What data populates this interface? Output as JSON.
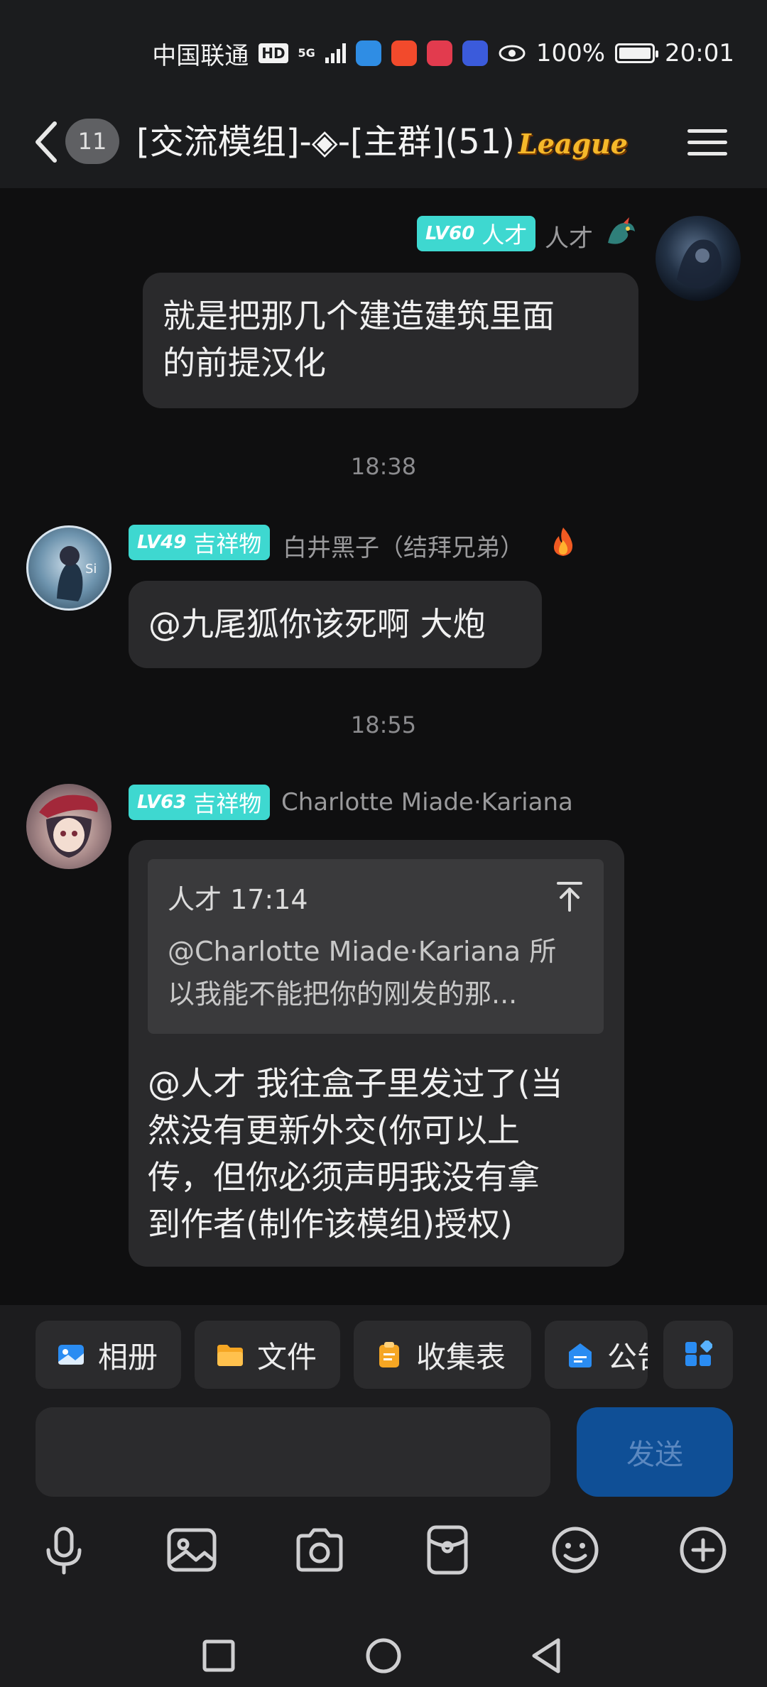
{
  "status_bar": {
    "carrier": "中国联通",
    "hd": "HD",
    "network": "5G",
    "battery": "100%",
    "time": "20:01"
  },
  "header": {
    "unread_count": "11",
    "title": "[交流模组]-◈-[主群](51)",
    "badge": "League"
  },
  "messages": [
    {
      "level": "LV60",
      "role": "人才",
      "sender": "人才",
      "text_lines": [
        "就是把那几个建造建筑里面",
        "的前提汉化"
      ]
    },
    {
      "time": "18:38",
      "level": "LV49",
      "role": "吉祥物",
      "sender": "白井黑子（结拜兄弟）",
      "text": "@九尾狐你该死啊 大炮"
    },
    {
      "time": "18:55",
      "level": "LV63",
      "role": "吉祥物",
      "sender": "Charlotte Miade·Kariana",
      "quote_header": "人才 17:14",
      "quote_lines": [
        "@Charlotte Miade·Kariana 所",
        "以我能不能把你的刚发的那..."
      ],
      "text_lines": [
        "@人才 我往盒子里发过了(当",
        "然没有更新外交(你可以上",
        "传，但你必须声明我没有拿",
        "到作者(制作该模组)授权)"
      ]
    }
  ],
  "toolbar": {
    "album": "相册",
    "file": "文件",
    "form": "收集表",
    "notice": "公告"
  },
  "input": {
    "send_label": "发送"
  },
  "colors": {
    "level_badge": "#3ed8d0",
    "send_button": "#0f4f96",
    "bubble": "#2a2a2c"
  }
}
